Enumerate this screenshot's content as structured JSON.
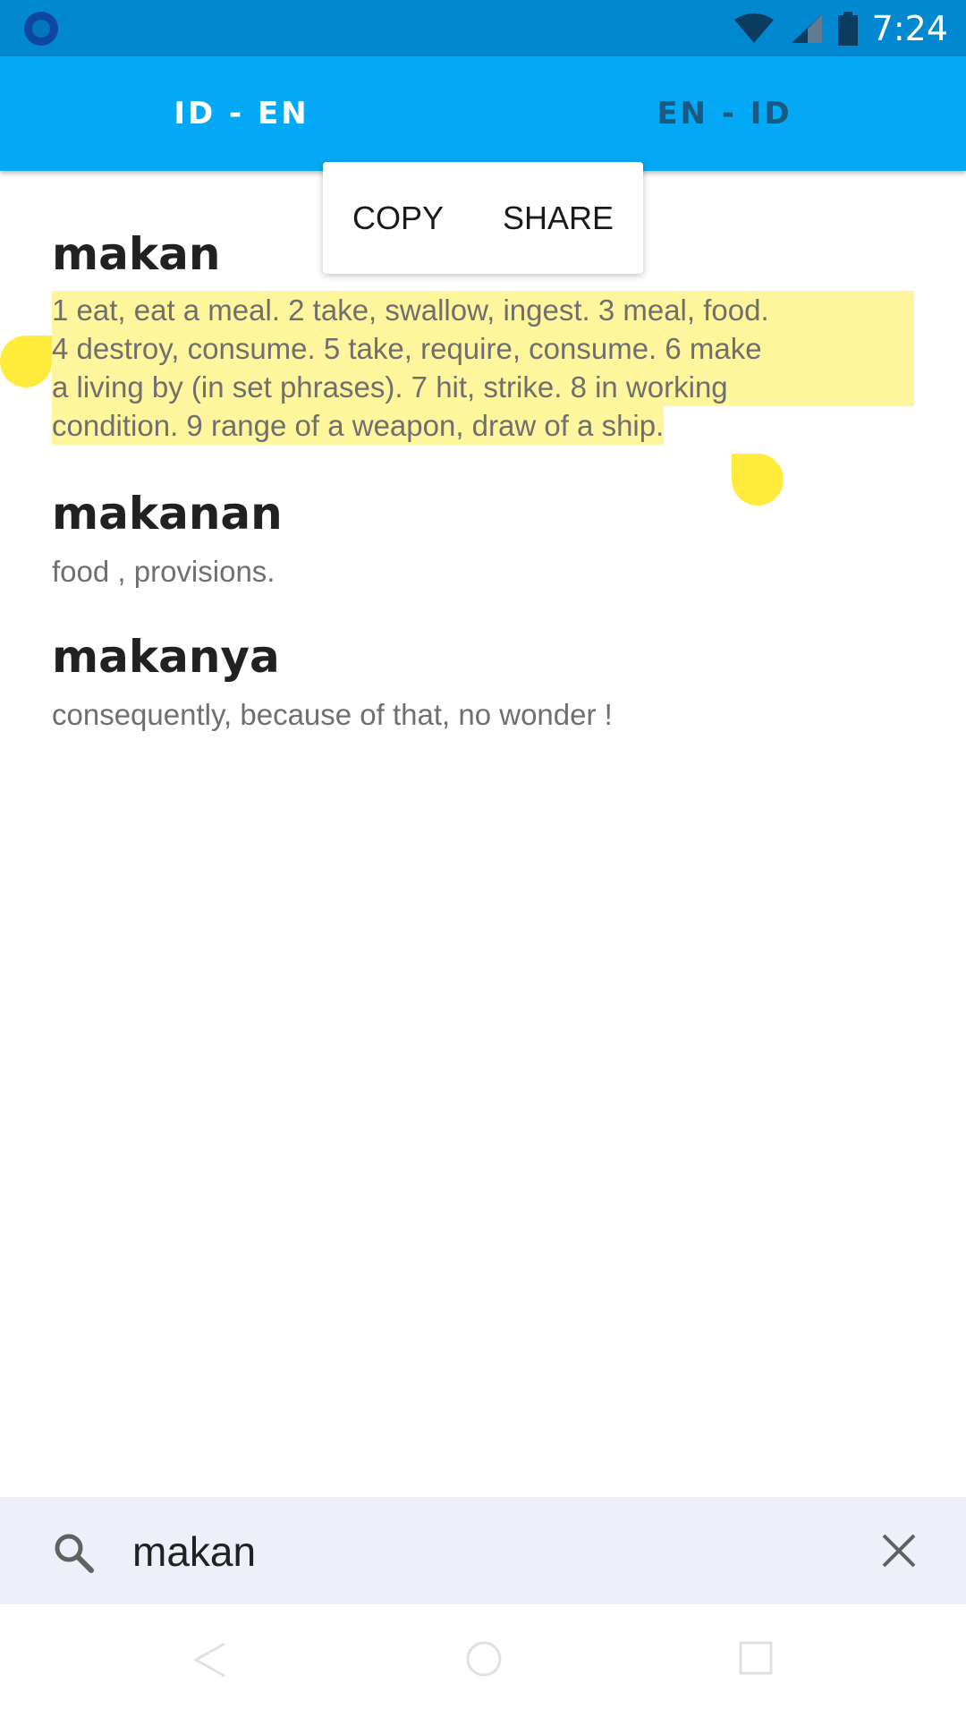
{
  "status_bar": {
    "time": "7:24",
    "icons": [
      "app-notification-icon",
      "wifi-icon",
      "signal-icon",
      "battery-icon"
    ]
  },
  "tabs": [
    {
      "label": "ID - EN",
      "active": true
    },
    {
      "label": "EN - ID",
      "active": false
    }
  ],
  "context_menu": {
    "copy_label": "COPY",
    "share_label": "SHARE"
  },
  "entries": [
    {
      "word": "makan",
      "definition_lines": [
        "1 eat, eat a meal. 2 take, swallow, ingest. 3 meal, food.",
        "4 destroy, consume. 5 take, require, consume. 6 make",
        "a living by (in set phrases). 7 hit, strike. 8 in working",
        "condition. 9 range of a weapon, draw of a ship."
      ]
    },
    {
      "word": "makanan",
      "definition": "food , provisions."
    },
    {
      "word": "makanya",
      "definition": "consequently, because of that, no wonder !"
    }
  ],
  "search": {
    "value": "makan",
    "icon": "search-icon",
    "clear_icon": "close-icon"
  },
  "colors": {
    "status_bar": "#0288d1",
    "tab_bar": "#03a9f4",
    "selection": "#fff59d",
    "handle": "#ffeb3b",
    "search_bg": "#eef0f9"
  }
}
